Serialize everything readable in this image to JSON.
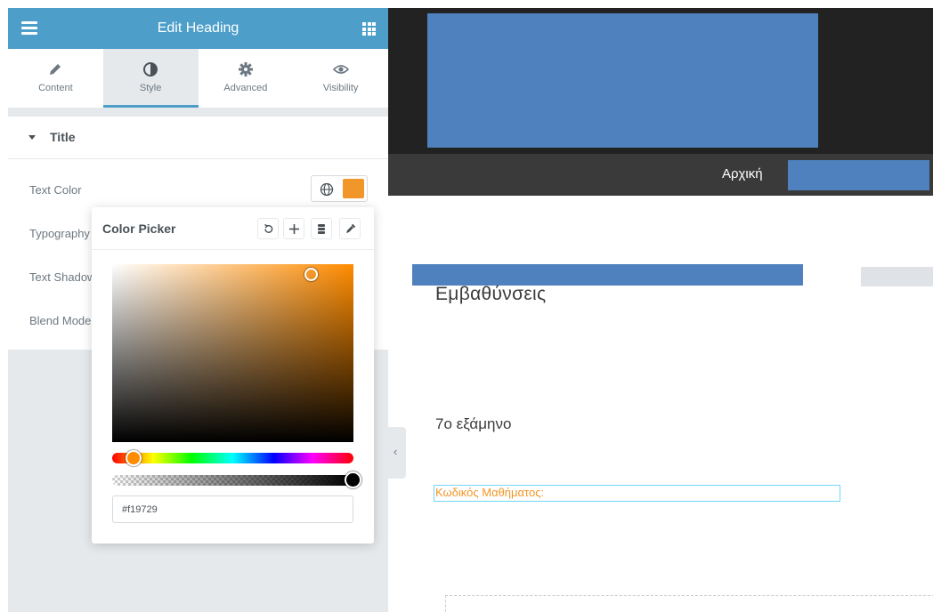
{
  "panel": {
    "title": "Edit Heading",
    "tabs": [
      {
        "label": "Content",
        "icon": "pencil-icon",
        "active": false
      },
      {
        "label": "Style",
        "icon": "contrast-icon",
        "active": true
      },
      {
        "label": "Advanced",
        "icon": "gear-icon",
        "active": false
      },
      {
        "label": "Visibility",
        "icon": "eye-icon",
        "active": false
      }
    ],
    "section_title": "Title",
    "controls": {
      "text_color": "Text Color",
      "typography": "Typography",
      "text_shadow": "Text Shadow",
      "blend_mode": "Blend Mode"
    },
    "selected_color": "#f19729"
  },
  "color_picker": {
    "title": "Color Picker",
    "hex_value": "#f19729",
    "hue_color": "#ff8c00",
    "alpha": 1.0
  },
  "preview": {
    "nav_home": "Αρχική",
    "heading_specializations": "Εμβαθύνσεις",
    "heading_semester": "7ο εξάμηνο",
    "course_code_label": "Κωδικός Μαθήματος:"
  },
  "colors": {
    "panel_accent": "#4d9fc9",
    "placeholder_blue": "#4e81bd",
    "heading_orange": "#f19729"
  }
}
